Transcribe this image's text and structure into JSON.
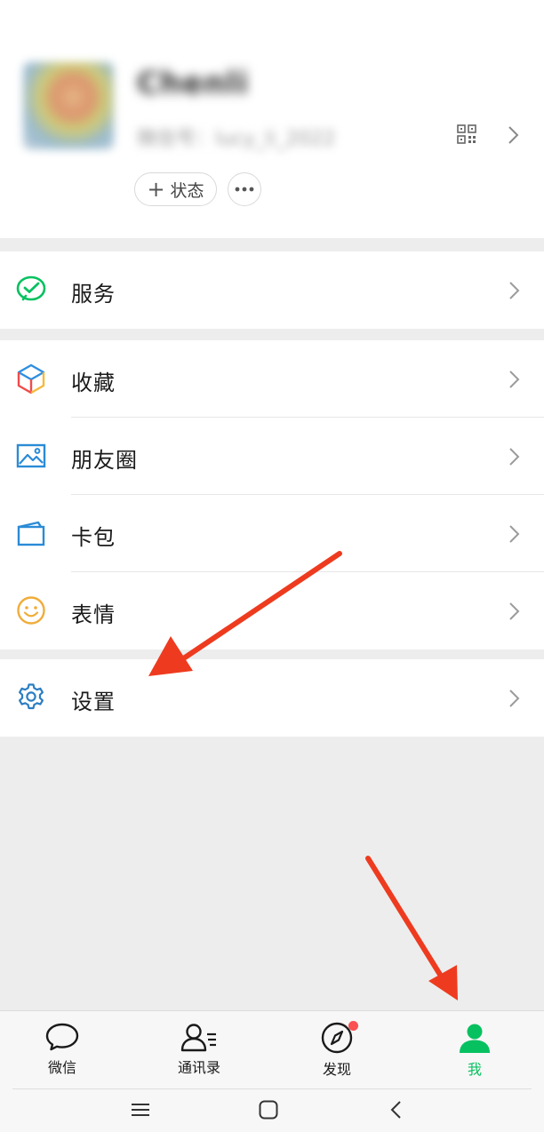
{
  "profile": {
    "nickname": "Chenli",
    "wechat_id": "微信号：lucy_li_2022",
    "status_button_label": "状态",
    "status_button_plus": "+"
  },
  "menu": {
    "services": {
      "label": "服务",
      "icon": "wechat-pay-icon"
    },
    "favorites": {
      "label": "收藏",
      "icon": "cube-icon"
    },
    "moments": {
      "label": "朋友圈",
      "icon": "image-icon"
    },
    "cards": {
      "label": "卡包",
      "icon": "wallet-card-icon"
    },
    "stickers": {
      "label": "表情",
      "icon": "smiley-icon"
    },
    "settings": {
      "label": "设置",
      "icon": "gear-icon"
    }
  },
  "tabbar": {
    "tabs": [
      {
        "label": "微信",
        "icon": "chat-bubble-icon",
        "active": false
      },
      {
        "label": "通讯录",
        "icon": "contacts-icon",
        "active": false
      },
      {
        "label": "发现",
        "icon": "compass-icon",
        "active": false,
        "badge": true
      },
      {
        "label": "我",
        "icon": "person-icon",
        "active": true
      }
    ]
  },
  "colors": {
    "accent_green": "#07c160",
    "badge_red": "#fa5151",
    "annotation_arrow": "#ee3b1f",
    "background": "#ededed"
  }
}
